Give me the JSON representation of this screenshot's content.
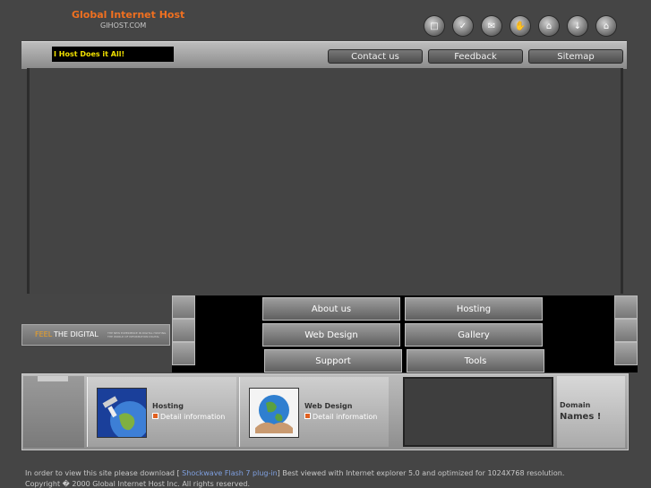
{
  "brand": {
    "title": "Global Internet Host",
    "subtitle": "GIHOST.COM"
  },
  "top_icons": [
    "chat-icon",
    "check-icon",
    "mail-icon",
    "hand-icon",
    "home-icon",
    "download-icon",
    "house-icon"
  ],
  "tagline": "I Host Does it All!",
  "topnav": {
    "contact": "Contact us",
    "feedback": "Feedback",
    "sitemap": "Sitemap"
  },
  "feel": {
    "part1": "FEEL",
    "part2": " THE DIGITAL",
    "fine_print": "THE NEW EXPERIENCE IN DIGITAL HOSTING THE WORLD OF INFORMATION DIGITAL"
  },
  "nav": {
    "about": "About us",
    "hosting": "Hosting",
    "webdesign": "Web Design",
    "gallery": "Gallery",
    "support": "Support",
    "tools": "Tools"
  },
  "services": [
    {
      "title": "Hosting",
      "detail": "Detail information"
    },
    {
      "title": "Web Design",
      "detail": "Detail information"
    }
  ],
  "domain": {
    "line1": "Domain",
    "line2": "Names !"
  },
  "footer": {
    "pre": "In order to view this site please download [ ",
    "link": "Shockwave Flash 7 plug-in",
    "post": "] Best viewed with Internet explorer 5.0 and optimized for 1024X768 resolution.",
    "copyright": "Copyright � 2000 Global Internet Host Inc. All rights reserved."
  }
}
